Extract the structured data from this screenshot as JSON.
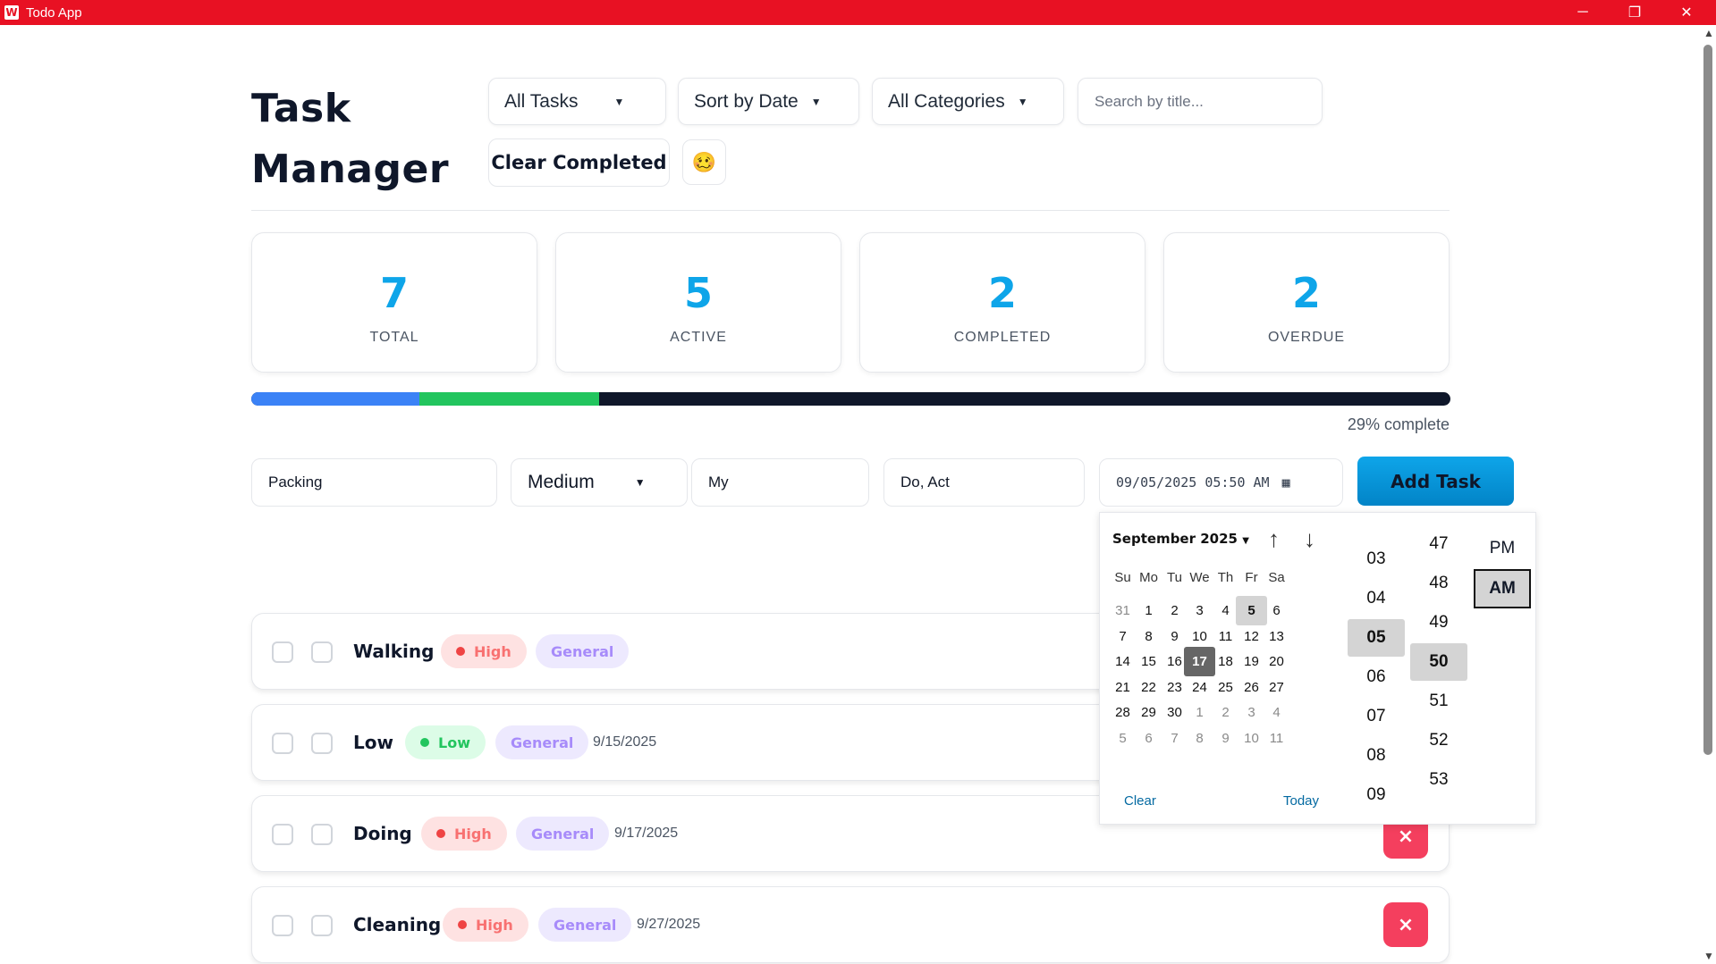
{
  "window": {
    "title": "Todo App",
    "icon": "W"
  },
  "header": {
    "title_line1": "Task",
    "title_line2": "Manager",
    "filter_status": "All Tasks",
    "sort": "Sort by Date",
    "filter_category": "All Categories",
    "search_placeholder": "Search by title...",
    "clear_completed": "Clear Completed",
    "theme_emoji": "🥴"
  },
  "stats": [
    {
      "value": "7",
      "label": "TOTAL"
    },
    {
      "value": "5",
      "label": "ACTIVE"
    },
    {
      "value": "2",
      "label": "COMPLETED"
    },
    {
      "value": "2",
      "label": "OVERDUE"
    }
  ],
  "progress": {
    "text": "29% complete",
    "blue_fraction": 0.14,
    "green_fraction": 0.29,
    "colors": {
      "track": "#0f172a",
      "blue": "#3b82f6",
      "green": "#22c55e"
    }
  },
  "form": {
    "title_value": "Packing",
    "priority": "Medium",
    "category_value": "My",
    "tags_value": "Do, Act",
    "datetime_value": "09/05/2025 05:50 AM",
    "add_button": "Add Task"
  },
  "tasks": [
    {
      "title": "Walking",
      "priority": "High",
      "category": "General",
      "date": ""
    },
    {
      "title": "Low",
      "priority": "Low",
      "category": "General",
      "date": "9/15/2025"
    },
    {
      "title": "Doing",
      "priority": "High",
      "category": "General",
      "date": "9/17/2025"
    },
    {
      "title": "Cleaning",
      "priority": "High",
      "category": "General",
      "date": "9/27/2025"
    }
  ],
  "delete_icon": "×",
  "datepicker": {
    "month": "September 2025",
    "weekdays": [
      "Su",
      "Mo",
      "Tu",
      "We",
      "Th",
      "Fr",
      "Sa"
    ],
    "weeks": [
      [
        "31",
        "1",
        "2",
        "3",
        "4",
        "5",
        "6"
      ],
      [
        "7",
        "8",
        "9",
        "10",
        "11",
        "12",
        "13"
      ],
      [
        "14",
        "15",
        "16",
        "17",
        "18",
        "19",
        "20"
      ],
      [
        "21",
        "22",
        "23",
        "24",
        "25",
        "26",
        "27"
      ],
      [
        "28",
        "29",
        "30",
        "1",
        "2",
        "3",
        "4"
      ],
      [
        "5",
        "6",
        "7",
        "8",
        "9",
        "10",
        "11"
      ]
    ],
    "selected_day": "5",
    "today_day": "17",
    "clear": "Clear",
    "today": "Today",
    "hours": [
      "03",
      "04",
      "05",
      "06",
      "07",
      "08",
      "09"
    ],
    "selected_hour": "05",
    "minutes": [
      "47",
      "48",
      "49",
      "50",
      "51",
      "52",
      "53"
    ],
    "selected_minute": "50",
    "ampm": [
      "PM",
      "AM"
    ],
    "selected_ampm": "AM"
  }
}
